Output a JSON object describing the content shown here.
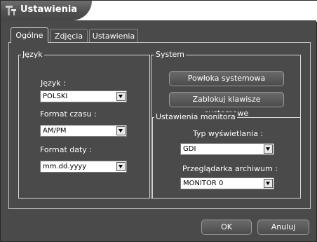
{
  "window": {
    "title": "Ustawienia"
  },
  "tabs": [
    {
      "label": "Ogólne"
    },
    {
      "label": "Zdjęcia"
    },
    {
      "label": "Ustawienia"
    }
  ],
  "language_group": {
    "legend": "Język",
    "language_label": "Język :",
    "language_value": "POLSKI",
    "time_format_label": "Format czasu :",
    "time_format_value": "AM/PM",
    "date_format_label": "Format daty :",
    "date_format_value": "mm.dd.yyyy"
  },
  "system_group": {
    "legend": "System",
    "shell_button": "Powłoka systemowa",
    "lock_keys_button": "Zablokuj klawisze systemowe"
  },
  "monitor_group": {
    "legend": "Ustawienia monitora",
    "display_type_label": "Typ wyświetlania :",
    "display_type_value": "GDI",
    "archive_viewer_label": "Przeglądarka archiwum :",
    "archive_viewer_value": "MONITOR 0"
  },
  "footer": {
    "ok_label": "OK",
    "cancel_label": "Anuluj"
  }
}
